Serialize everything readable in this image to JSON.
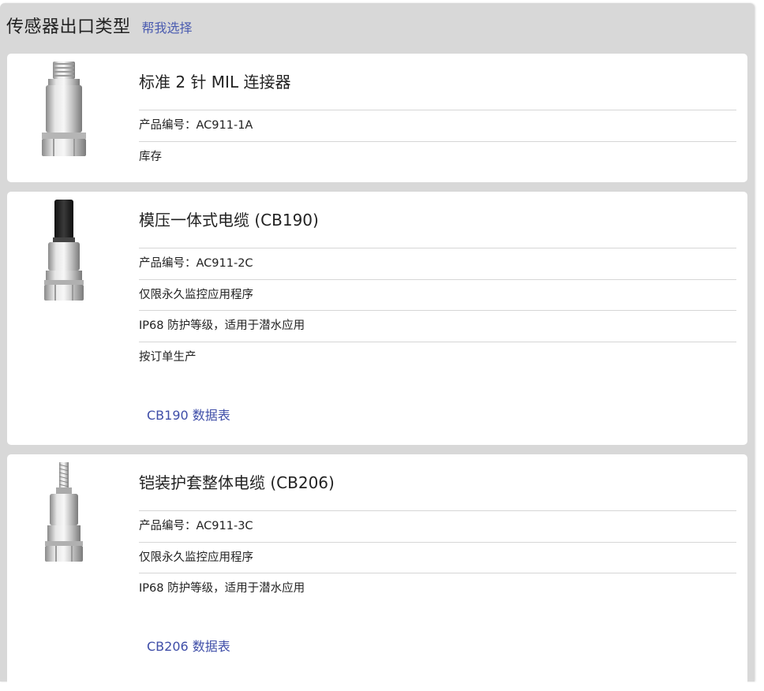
{
  "header": {
    "title": "传感器出口类型",
    "help_link": "帮我选择"
  },
  "products": [
    {
      "name": "标准 2 针 MIL 连接器",
      "part_number": "产品编号：AC911-1A",
      "features": [],
      "availability": "库存",
      "image": "connector-sensor-image"
    },
    {
      "name": "模压一体式电缆 (CB190)",
      "part_number": "产品编号：AC911-2C",
      "features": [
        "仅限永久监控应用程序",
        "IP68 防护等级，适用于潜水应用"
      ],
      "availability": "按订单生产",
      "datasheet": "CB190 数据表",
      "image": "molded-cable-sensor-image"
    },
    {
      "name": "铠装护套整体电缆 (CB206)",
      "part_number": "产品编号：AC911-3C",
      "features": [
        "仅限永久监控应用程序",
        "IP68 防护等级，适用于潜水应用"
      ],
      "datasheet": "CB206 数据表",
      "image": "armored-cable-sensor-image"
    }
  ]
}
